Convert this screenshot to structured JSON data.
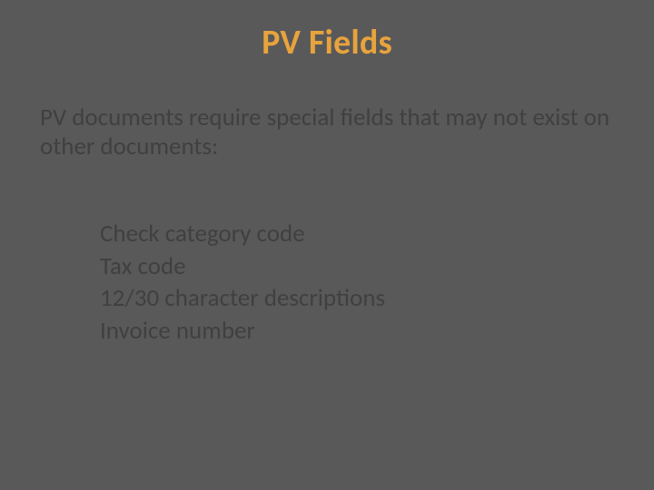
{
  "title": "PV Fields",
  "intro": "PV documents require special fields that may not exist on other documents:",
  "items": [
    "Check category code",
    "Tax code",
    "12/30 character descriptions",
    "Invoice number"
  ]
}
